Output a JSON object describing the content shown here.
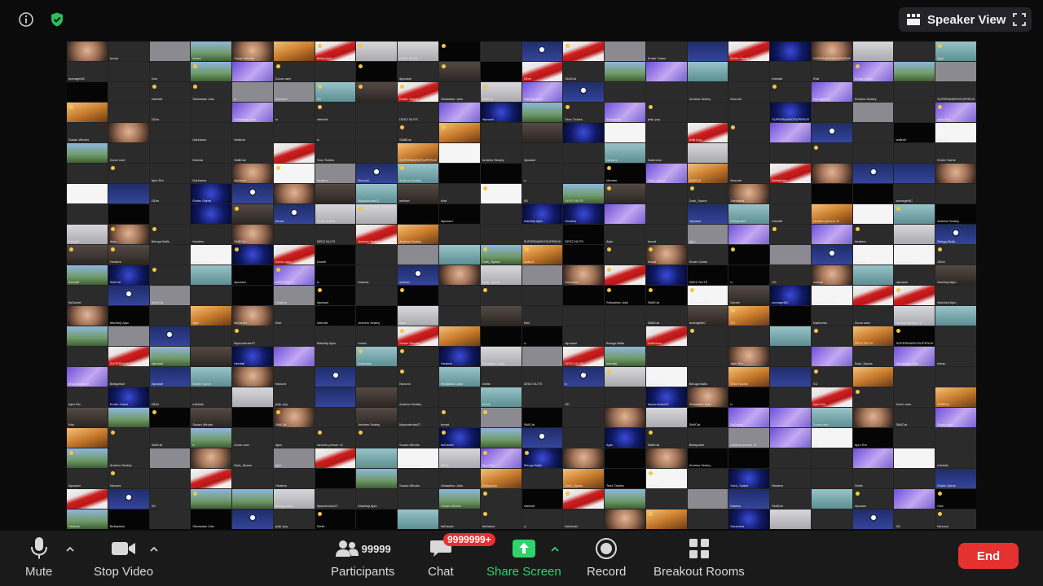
{
  "topbar": {
    "speaker_view_label": "Speaker View",
    "icons": [
      "info-icon",
      "shield-check-icon",
      "speaker-view-grid-icon",
      "fullscreen-icon"
    ],
    "shield_color": "#27c25c"
  },
  "gallery": {
    "participant_names": [
      "Heaters",
      "SkillCat",
      "bread",
      "Darkness",
      "Bellaphish",
      "Susan Winder",
      "Beluga Balls",
      "Mamas",
      "Andrew Sealey",
      "DEEZ NUTS",
      "random person :D",
      "Tess Tickles",
      "Mysonbroke27",
      "Dielle",
      "Interlatt",
      "SUPERMARIOSUPERUK",
      "Daniel",
      "Sebastian Julio",
      "jertjr jury",
      "averageMC",
      "Nezumi",
      "Ajen Rm",
      "Ender Game",
      "MacNeji Ajan",
      "dipcasei",
      "Kiwi",
      "SkilliCat",
      "ItsDaniel",
      "Dark_Space",
      "ZiDer",
      "Zoom user",
      "wellnef",
      "Ajan",
      "lo",
      "XD"
    ]
  },
  "toolbar": {
    "mute_label": "Mute",
    "stop_video_label": "Stop Video",
    "participants_label": "Participants",
    "participants_count": "99999",
    "chat_label": "Chat",
    "chat_badge": "9999999+",
    "share_screen_label": "Share Screen",
    "record_label": "Record",
    "breakout_rooms_label": "Breakout Rooms",
    "end_label": "End",
    "colors": {
      "share_green": "#2fd36b",
      "end_red": "#e5312f",
      "badge_red": "#e5312f"
    }
  }
}
